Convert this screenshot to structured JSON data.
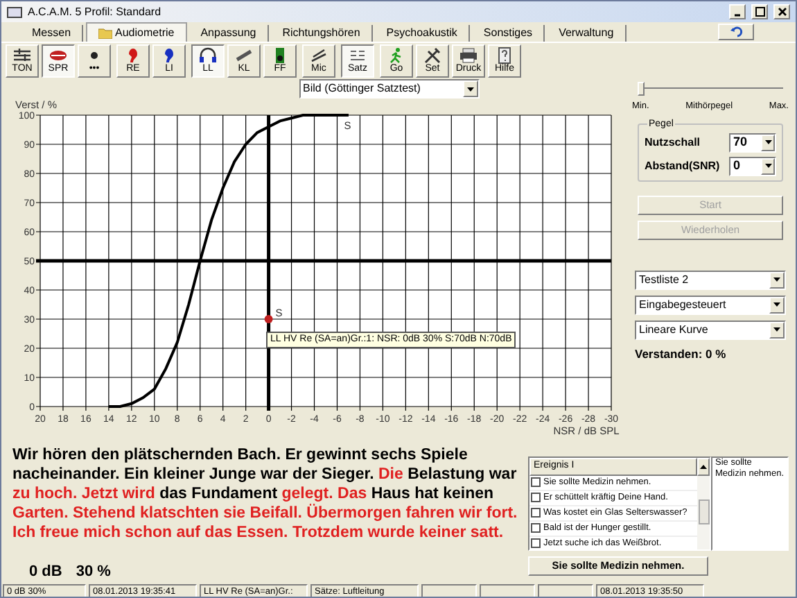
{
  "window": {
    "title": "A.C.A.M. 5  Profil: Standard"
  },
  "tabs": [
    {
      "label": "Messen",
      "selected": false
    },
    {
      "label": "Audiometrie",
      "selected": true
    },
    {
      "label": "Anpassung",
      "selected": false
    },
    {
      "label": "Richtungshören",
      "selected": false
    },
    {
      "label": "Psychoakustik",
      "selected": false
    },
    {
      "label": "Sonstiges",
      "selected": false
    },
    {
      "label": "Verwaltung",
      "selected": false
    }
  ],
  "toolbar": [
    [
      {
        "label": "TON",
        "kind": "ton",
        "selected": false
      },
      {
        "label": "SPR",
        "kind": "lips",
        "selected": true
      },
      {
        "label": "•••",
        "kind": "dot",
        "selected": false
      }
    ],
    [
      {
        "label": "RE",
        "kind": "ear-red",
        "selected": false
      },
      {
        "label": "LI",
        "kind": "ear-blue",
        "selected": false
      }
    ],
    [
      {
        "label": "LL",
        "kind": "headphones",
        "selected": true
      },
      {
        "label": "KL",
        "kind": "bone",
        "selected": false
      },
      {
        "label": "FF",
        "kind": "speaker",
        "selected": false
      }
    ],
    [
      {
        "label": "Mic",
        "kind": "mic",
        "selected": false
      }
    ],
    [
      {
        "label": "Satz",
        "kind": "sz",
        "selected": true
      }
    ],
    [
      {
        "label": "Go",
        "kind": "run",
        "selected": false
      },
      {
        "label": "Set",
        "kind": "tools",
        "selected": false
      },
      {
        "label": "Druck",
        "kind": "printer",
        "selected": false
      },
      {
        "label": "Hilfe",
        "kind": "help",
        "selected": false
      }
    ]
  ],
  "test_select": "Bild (Göttinger Satztest)",
  "chart_data": {
    "type": "line",
    "ylabel": "Verst / %",
    "xlabel": "NSR / dB SPL",
    "x": [
      14,
      13,
      12,
      11,
      10,
      9,
      8,
      7,
      6,
      5,
      4,
      3,
      2,
      1,
      0,
      -1,
      -2,
      -3,
      -4,
      -5,
      -6,
      -7
    ],
    "series": [
      {
        "color": "#000000",
        "values": [
          0,
          0,
          1,
          3,
          6,
          13,
          22,
          35,
          50,
          64,
          75,
          84,
          90,
          94,
          96,
          98,
          99,
          100,
          100,
          100,
          100,
          100
        ]
      },
      {
        "color": "#c02020",
        "marker": true,
        "values": [
          null,
          null,
          null,
          null,
          null,
          null,
          null,
          null,
          null,
          null,
          null,
          null,
          null,
          null,
          30,
          null,
          null,
          null,
          null,
          null,
          null,
          null
        ]
      }
    ],
    "grid": true,
    "ref_lines": [
      {
        "axis": "y",
        "value": 50
      },
      {
        "axis": "x",
        "value": 0
      }
    ],
    "xlim": [
      20,
      -30
    ],
    "ylim": [
      0,
      100
    ],
    "xticks": [
      20,
      18,
      16,
      14,
      12,
      10,
      8,
      6,
      4,
      2,
      0,
      -2,
      -4,
      -6,
      -8,
      -10,
      -12,
      -14,
      -16,
      -18,
      -20,
      -22,
      -24,
      -26,
      -28,
      -30
    ],
    "yticks": [
      0,
      10,
      20,
      30,
      40,
      50,
      60,
      70,
      80,
      90,
      100
    ],
    "annotations": [
      {
        "x": 0,
        "y": 30,
        "text": "S"
      },
      {
        "x": -6,
        "y": 99,
        "text": "S"
      }
    ]
  },
  "chart_tooltip": "LL HV Re (SA=an)Gr.:1: NSR: 0dB 30% S:70dB N:70dB",
  "slider": {
    "level": 0,
    "min_label": "Min.",
    "label": "Mithörpegel",
    "max_label": "Max."
  },
  "pegel": {
    "title": "Pegel",
    "fields": [
      {
        "label": "Nutzschall",
        "value": "70"
      },
      {
        "label": "Abstand(SNR)",
        "value": "0"
      }
    ]
  },
  "buttons": [
    {
      "label": "Start",
      "disabled": true
    },
    {
      "label": "Wiederholen",
      "disabled": true
    }
  ],
  "selects": [
    "Testliste 2",
    "Eingabegesteuert",
    "Lineare Kurve"
  ],
  "verstanden": "Verstanden: 0 %",
  "sentence": [
    {
      "text": "Wir hören den plätschernden Bach. Er gewinnt sechs Spiele nacheinander. Ein kleiner Junge war der Sieger.",
      "understood": true
    },
    {
      "text": "Die",
      "understood": false
    },
    {
      "text": "Belastung war",
      "understood": true
    },
    {
      "text": "zu hoch. Jetzt wird",
      "understood": false
    },
    {
      "text": "das Fundament",
      "understood": true
    },
    {
      "text": "gelegt. Das",
      "understood": false
    },
    {
      "text": "Haus hat keinen",
      "understood": true
    },
    {
      "text": "Garten. Stehend klatschten sie Beifall. Übermorgen fahren wir fort. Ich freue mich schon auf das Essen. Trotzdem wurde keiner satt.",
      "understood": false
    }
  ],
  "events": {
    "header": "Ereignis I",
    "items": [
      {
        "label": "Sie sollte Medizin nehmen.",
        "checked": false
      },
      {
        "label": "Er schüttelt kräftig Deine Hand.",
        "checked": false
      },
      {
        "label": "Was kostet ein Glas Selterswasser?",
        "checked": false
      },
      {
        "label": "Bald ist der Hunger gestillt.",
        "checked": false
      },
      {
        "label": "Jetzt suche ich das Weißbrot.",
        "checked": false
      }
    ],
    "preview": "Sie sollte Medizin nehmen.",
    "button": "Sie sollte Medizin nehmen."
  },
  "result": {
    "snr": "0 dB",
    "percent": "30 %"
  },
  "status_bar": [
    "0 dB  30%",
    "08.01.2013 19:35:41",
    "LL HV Re (SA=an)Gr.:",
    "Sätze: Luftleitung",
    "08.01.2013 19:35:50"
  ]
}
